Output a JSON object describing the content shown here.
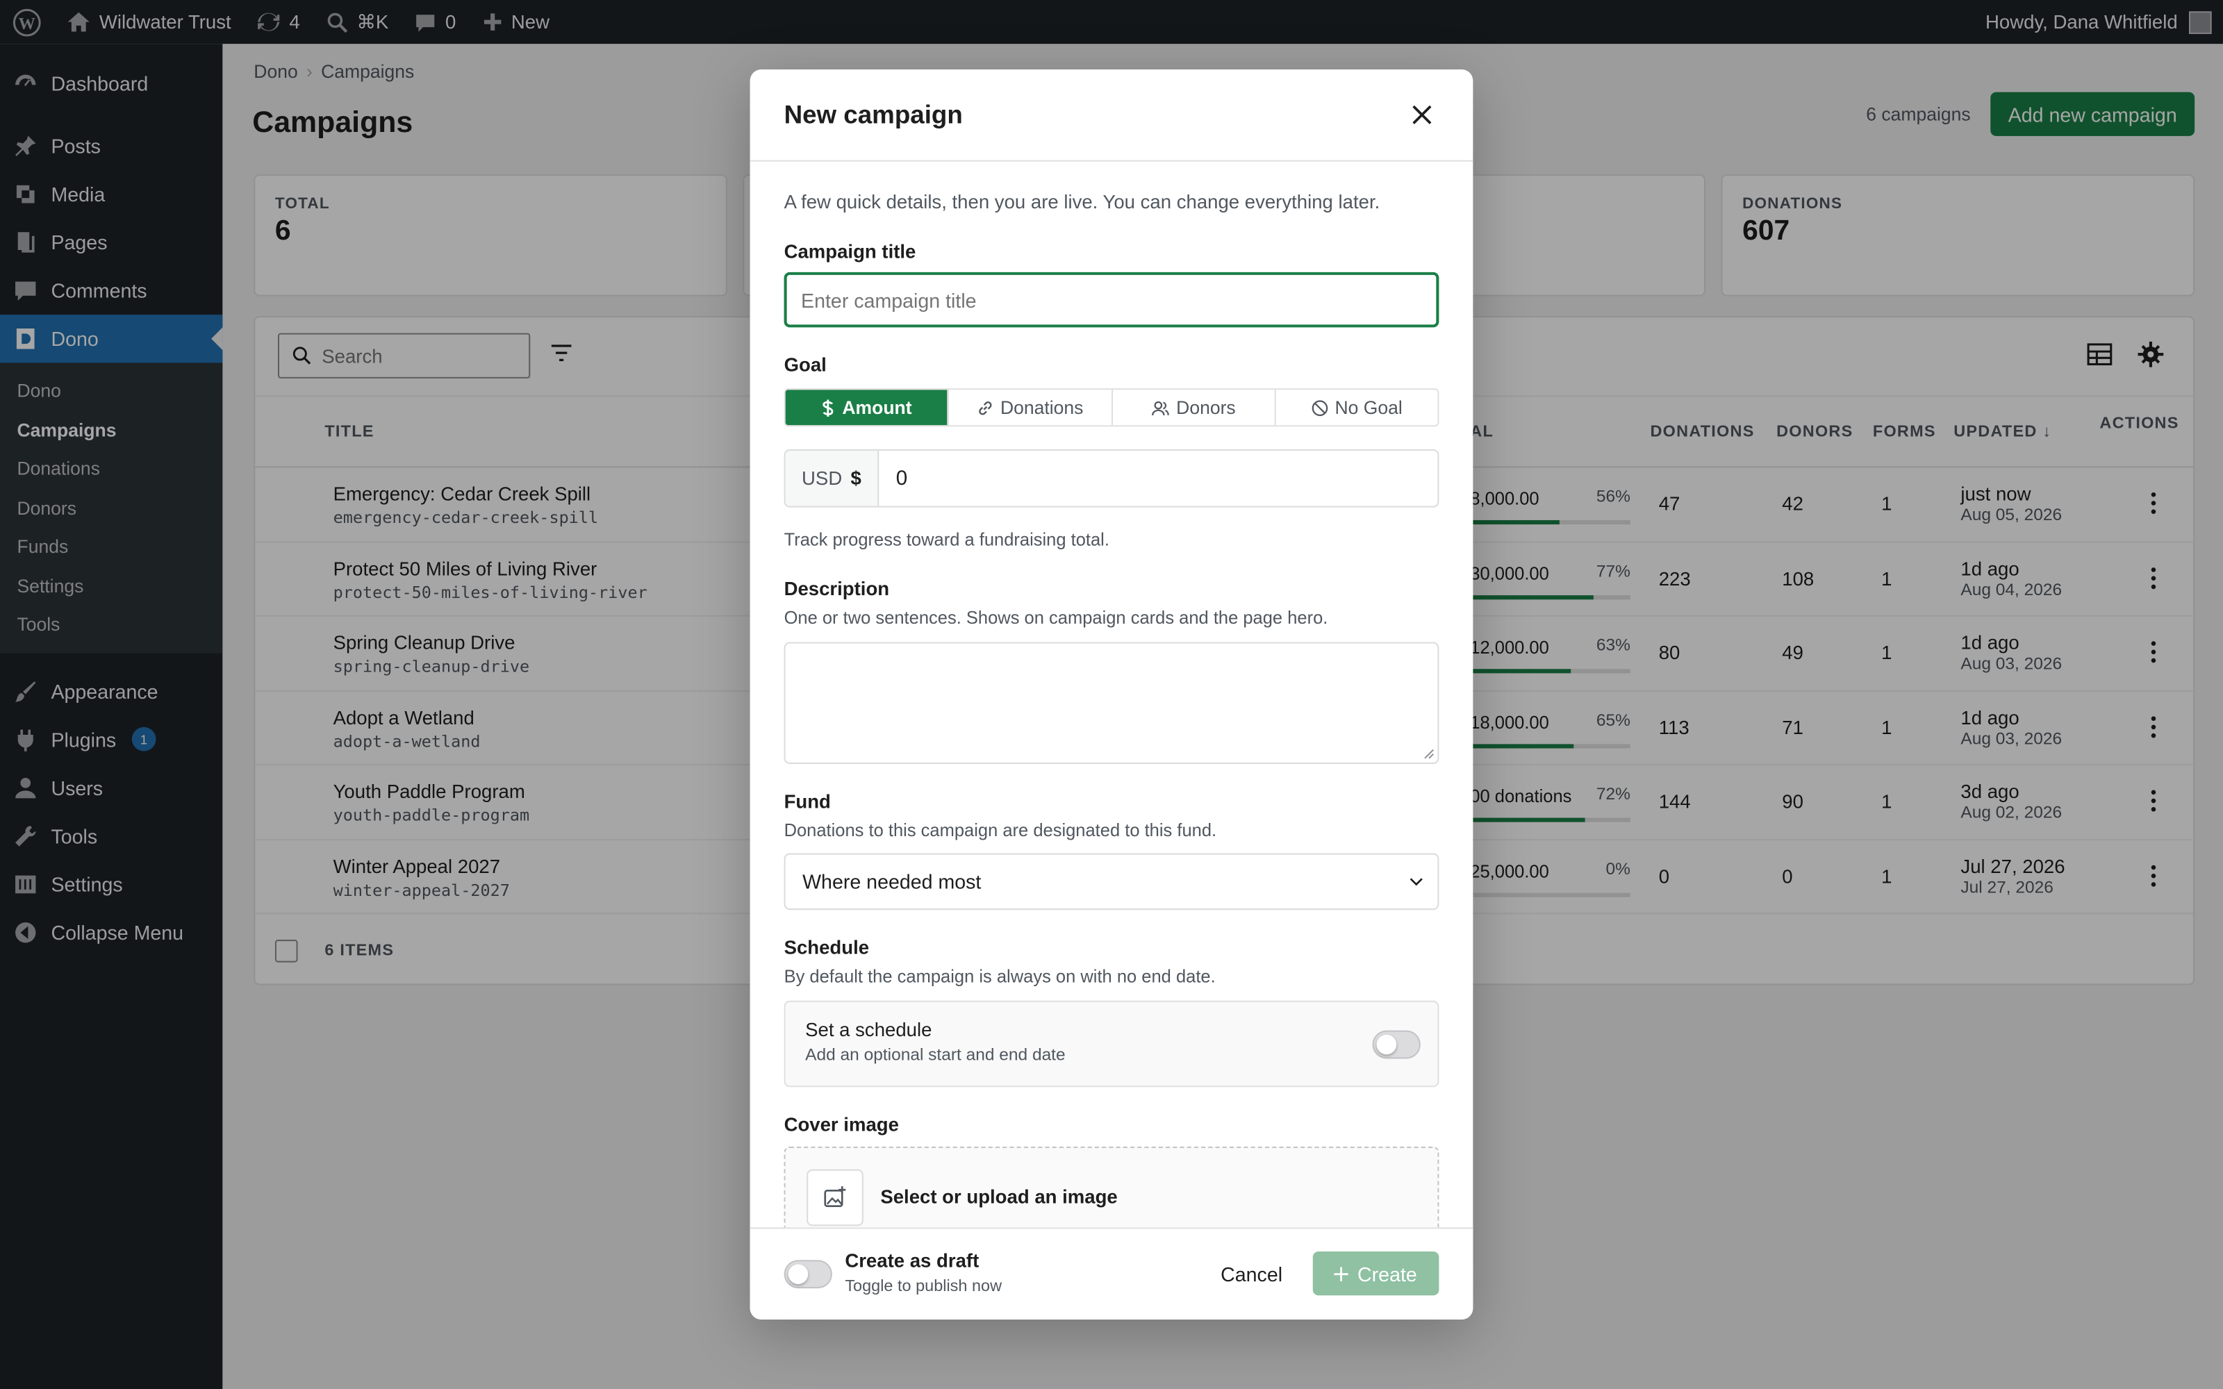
{
  "adminbar": {
    "site_name": "Wildwater Trust",
    "updates_count": "4",
    "search_shortcut": "⌘K",
    "comments_count": "0",
    "new_label": "New",
    "greeting": "Howdy, Dana Whitfield"
  },
  "sidebar": {
    "items": [
      {
        "label": "Dashboard",
        "icon": "dashboard-icon"
      },
      {
        "label": "Posts",
        "icon": "pin-icon"
      },
      {
        "label": "Media",
        "icon": "media-icon"
      },
      {
        "label": "Pages",
        "icon": "pages-icon"
      },
      {
        "label": "Comments",
        "icon": "comment-icon"
      },
      {
        "label": "Dono",
        "icon": "dono-icon"
      },
      {
        "label": "Appearance",
        "icon": "brush-icon"
      },
      {
        "label": "Plugins",
        "icon": "plugin-icon",
        "badge": "1"
      },
      {
        "label": "Users",
        "icon": "user-icon"
      },
      {
        "label": "Tools",
        "icon": "wrench-icon"
      },
      {
        "label": "Settings",
        "icon": "sliders-icon"
      },
      {
        "label": "Collapse Menu",
        "icon": "collapse-icon"
      }
    ],
    "submenu": [
      "Dono",
      "Campaigns",
      "Donations",
      "Donors",
      "Funds",
      "Settings",
      "Tools"
    ]
  },
  "page": {
    "breadcrumb": [
      "Dono",
      "Campaigns"
    ],
    "title": "Campaigns",
    "count": "6 campaigns",
    "add_button": "Add new campaign",
    "stats": [
      {
        "label": "TOTAL",
        "value": "6"
      },
      {
        "label": "DONATIONS",
        "value": "607"
      }
    ],
    "search_placeholder": "Search",
    "columns": {
      "title": "TITLE",
      "goal": "AL",
      "donations": "DONATIONS",
      "donors": "DONORS",
      "forms": "FORMS",
      "updated": "UPDATED ↓",
      "actions": "ACTIONS"
    },
    "rows": [
      {
        "title": "Emergency: Cedar Creek Spill",
        "slug": "emergency-cedar-creek-spill",
        "goal": "8,000.00",
        "pct": "56%",
        "fill": 0.56,
        "donations": "47",
        "donors": "42",
        "forms": "1",
        "updated": "just now",
        "date": "Aug 05, 2026"
      },
      {
        "title": "Protect 50 Miles of Living River",
        "slug": "protect-50-miles-of-living-river",
        "goal": "30,000.00",
        "pct": "77%",
        "fill": 0.77,
        "donations": "223",
        "donors": "108",
        "forms": "1",
        "updated": "1d ago",
        "date": "Aug 04, 2026"
      },
      {
        "title": "Spring Cleanup Drive",
        "slug": "spring-cleanup-drive",
        "goal": "12,000.00",
        "pct": "63%",
        "fill": 0.63,
        "donations": "80",
        "donors": "49",
        "forms": "1",
        "updated": "1d ago",
        "date": "Aug 03, 2026"
      },
      {
        "title": "Adopt a Wetland",
        "slug": "adopt-a-wetland",
        "goal": "18,000.00",
        "pct": "65%",
        "fill": 0.65,
        "donations": "113",
        "donors": "71",
        "forms": "1",
        "updated": "1d ago",
        "date": "Aug 03, 2026"
      },
      {
        "title": "Youth Paddle Program",
        "slug": "youth-paddle-program",
        "goal": "00 donations",
        "pct": "72%",
        "fill": 0.72,
        "donations": "144",
        "donors": "90",
        "forms": "1",
        "updated": "3d ago",
        "date": "Aug 02, 2026"
      },
      {
        "title": "Winter Appeal 2027",
        "slug": "winter-appeal-2027",
        "goal": "25,000.00",
        "pct": "0%",
        "fill": 0,
        "donations": "0",
        "donors": "0",
        "forms": "1",
        "updated": "Jul 27, 2026",
        "date": "Jul 27, 2026"
      }
    ],
    "footer_items": "6 ITEMS"
  },
  "modal": {
    "title": "New campaign",
    "intro": "A few quick details, then you are live. You can change everything later.",
    "campaign_title_label": "Campaign title",
    "campaign_title_placeholder": "Enter campaign title",
    "goal_label": "Goal",
    "goal_options": [
      "Amount",
      "Donations",
      "Donors",
      "No Goal"
    ],
    "goal_selected": "Amount",
    "currency": "USD",
    "currency_symbol": "$",
    "amount_value": "0",
    "goal_help": "Track progress toward a fundraising total.",
    "description_label": "Description",
    "description_help": "One or two sentences. Shows on campaign cards and the page hero.",
    "fund_label": "Fund",
    "fund_help": "Donations to this campaign are designated to this fund.",
    "fund_value": "Where needed most",
    "schedule_label": "Schedule",
    "schedule_help": "By default the campaign is always on with no end date.",
    "schedule_toggle_title": "Set a schedule",
    "schedule_toggle_help": "Add an optional start and end date",
    "cover_label": "Cover image",
    "cover_action": "Select or upload an image",
    "draft_title": "Create as draft",
    "draft_help": "Toggle to publish now",
    "cancel": "Cancel",
    "create": "Create"
  },
  "colors": {
    "accent": "#1a7f46",
    "wp_blue": "#2271b1",
    "dark": "#1d2327"
  }
}
